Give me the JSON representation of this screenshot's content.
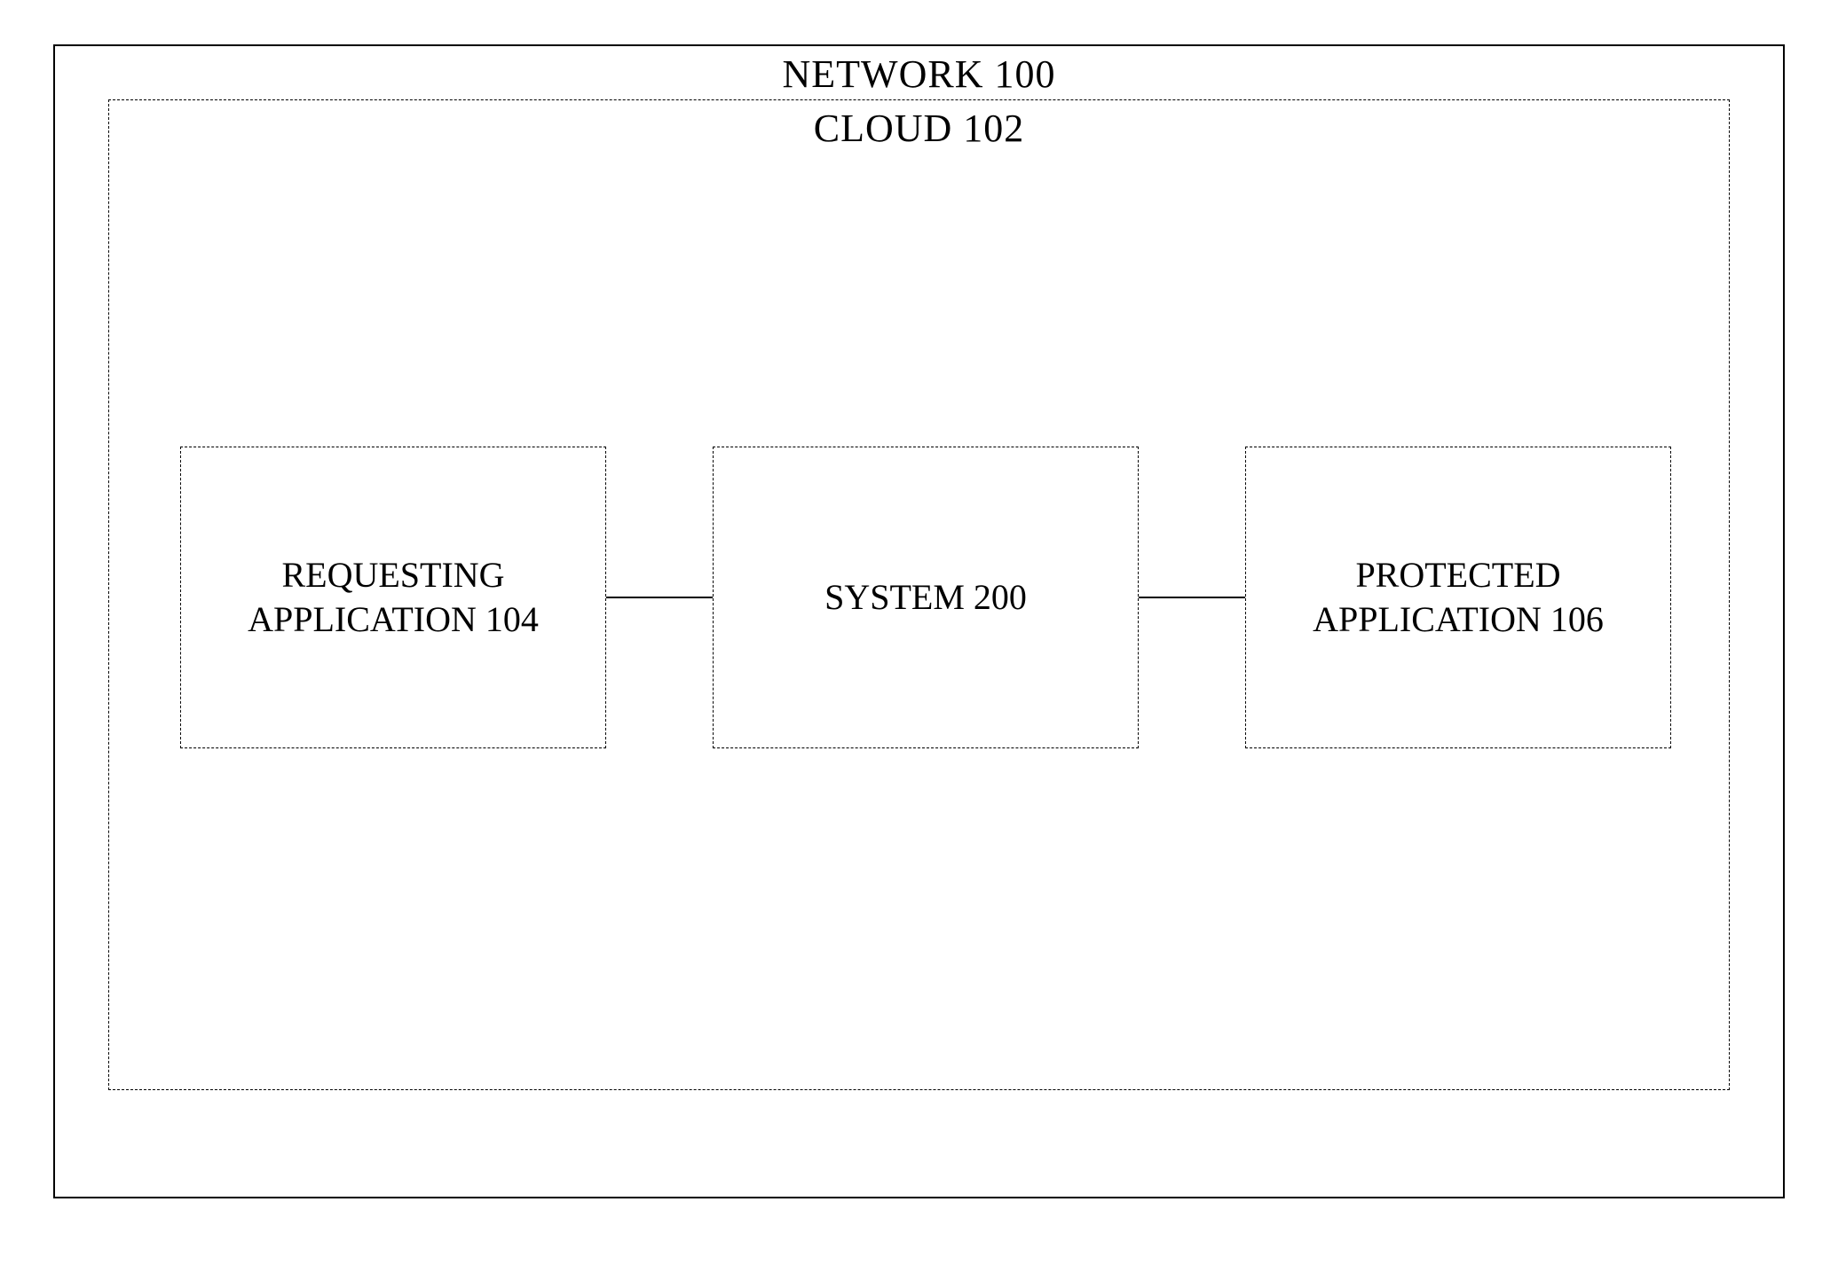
{
  "network": {
    "title": "NETWORK 100"
  },
  "cloud": {
    "title": "CLOUD 102",
    "nodes": {
      "requesting": {
        "line1": "REQUESTING",
        "line2": "APPLICATION 104"
      },
      "system": {
        "line1": "SYSTEM 200"
      },
      "protected": {
        "line1": "PROTECTED",
        "line2": "APPLICATION 106"
      }
    }
  }
}
